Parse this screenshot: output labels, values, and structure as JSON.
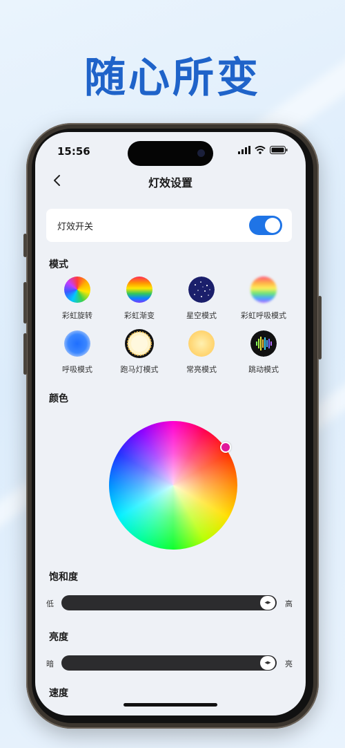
{
  "headline": "随心所变",
  "status": {
    "time": "15:56"
  },
  "nav": {
    "title": "灯效设置"
  },
  "switch_card": {
    "label": "灯效开关",
    "enabled": true
  },
  "sections": {
    "mode": "模式",
    "color": "颜色",
    "saturation": "饱和度",
    "brightness": "亮度",
    "speed": "速度"
  },
  "modes": [
    {
      "label": "彩虹旋转",
      "icon": "rainbow-spin-icon"
    },
    {
      "label": "彩虹渐变",
      "icon": "rainbow-gradient-icon"
    },
    {
      "label": "星空模式",
      "icon": "starry-sky-icon"
    },
    {
      "label": "彩虹呼吸模式",
      "icon": "rainbow-breath-icon"
    },
    {
      "label": "呼吸模式",
      "icon": "breath-icon"
    },
    {
      "label": "跑马灯模式",
      "icon": "marquee-icon"
    },
    {
      "label": "常亮模式",
      "icon": "steady-icon"
    },
    {
      "label": "跳动模式",
      "icon": "jump-icon"
    }
  ],
  "saturation_slider": {
    "min_label": "低",
    "max_label": "高",
    "value": 1.0,
    "thumb_glyph": "◂▸"
  },
  "brightness_slider": {
    "min_label": "暗",
    "max_label": "亮",
    "value": 1.0,
    "thumb_glyph": "◂▸"
  },
  "colors": {
    "accent": "#1f74e6",
    "headline": "#1f63c9",
    "selected_color": "#e0189a"
  }
}
